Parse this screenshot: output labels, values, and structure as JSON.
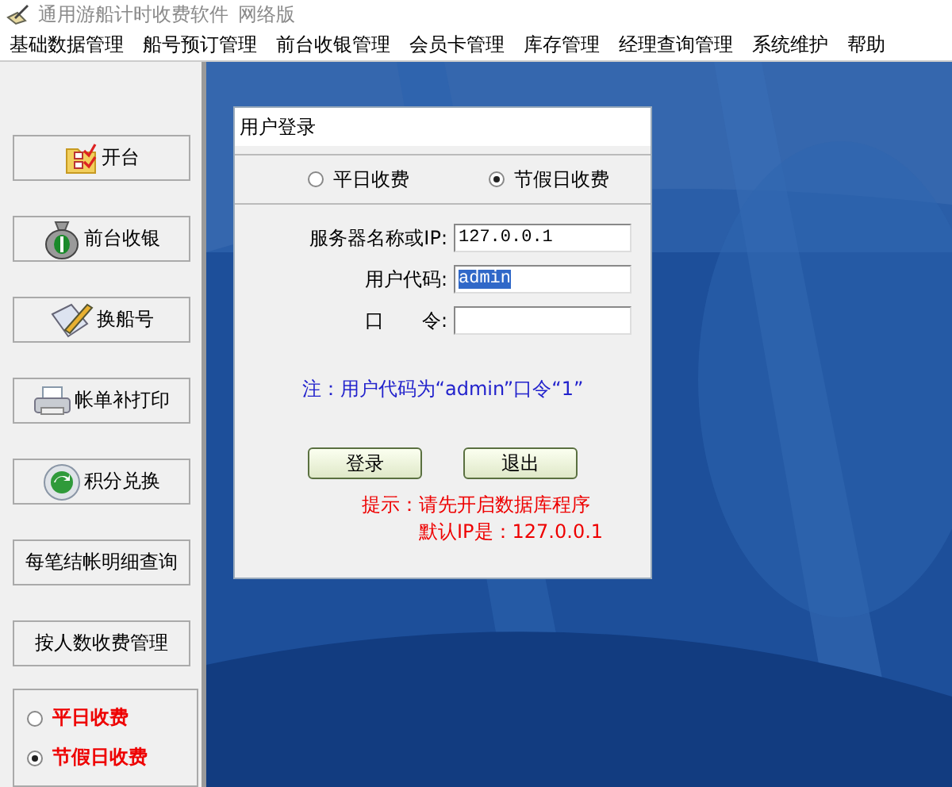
{
  "window": {
    "title": "通用游船计时收费软件",
    "edition": "网络版"
  },
  "menu": [
    "基础数据管理",
    "船号预订管理",
    "前台收银管理",
    "会员卡管理",
    "库存管理",
    "经理查询管理",
    "系统维护",
    "帮助"
  ],
  "sidebar": {
    "buttons": [
      "开台",
      "前台收银",
      "换船号",
      "帐单补打印",
      "积分兑换",
      "每笔结帐明细查询",
      "按人数收费管理"
    ],
    "rate_options": [
      {
        "label": "平日收费",
        "selected": false
      },
      {
        "label": "节假日收费",
        "selected": true
      }
    ]
  },
  "login_dialog": {
    "title": "用户登录",
    "rate_options": [
      {
        "label": "平日收费",
        "selected": false
      },
      {
        "label": "节假日收费",
        "selected": true
      }
    ],
    "fields": [
      {
        "label": "服务器名称或IP:",
        "value": "127.0.0.1",
        "text_selected": false
      },
      {
        "label": "用户代码:",
        "value": "admin",
        "text_selected": true
      },
      {
        "label": "口　　令:"
      }
    ],
    "note": "注：用户代码为“admin”口令“1”",
    "buttons": [
      "登录",
      "退出"
    ],
    "hint": [
      "提示：请先开启数据库程序",
      "默认IP是：127.0.0.1"
    ]
  }
}
